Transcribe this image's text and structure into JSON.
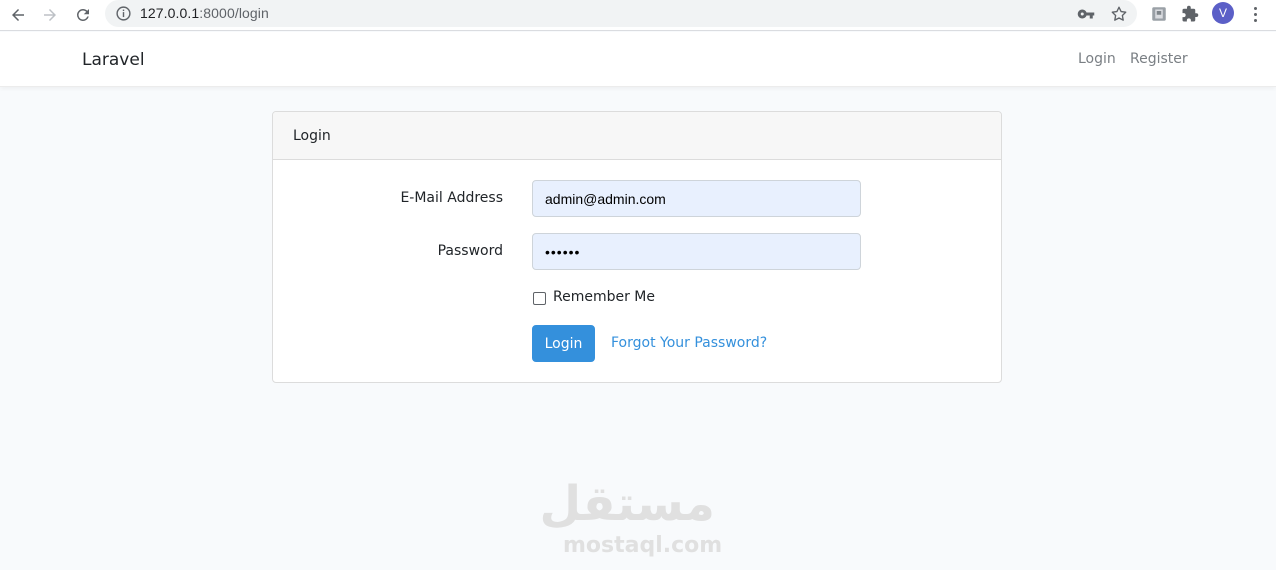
{
  "browser": {
    "url_host": "127.0.0.1",
    "url_path": ":8000/login",
    "avatar_letter": "V"
  },
  "navbar": {
    "brand": "Laravel",
    "login_link": "Login",
    "register_link": "Register"
  },
  "card": {
    "header": "Login",
    "email_label": "E-Mail Address",
    "email_value": "admin@admin.com",
    "password_label": "Password",
    "password_value": "••••••",
    "remember_label": "Remember Me",
    "remember_checked": false,
    "login_button": "Login",
    "forgot_link": "Forgot Your Password?"
  },
  "watermark": {
    "arabic": "مستقل",
    "latin": "mostaql.com"
  },
  "colors": {
    "primary": "#3490dc",
    "input_autofill": "#e8f0fe",
    "page_bg": "#f8fafc",
    "avatar": "#5b5fc7"
  }
}
